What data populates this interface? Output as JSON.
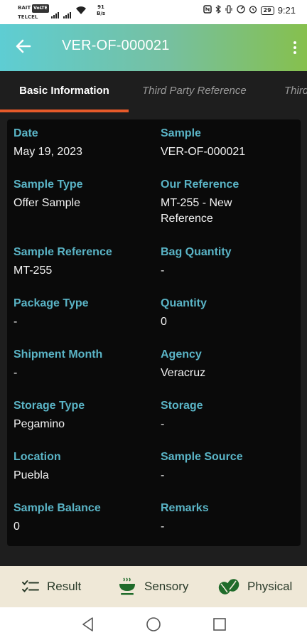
{
  "status_bar": {
    "carrier1": "BAIT",
    "carrier1_badge": "VoLTE",
    "carrier2": "TELCEL",
    "net_speed": "91",
    "net_unit": "B/s",
    "battery": "29",
    "time": "9:21"
  },
  "app_bar": {
    "title": "VER-OF-000021",
    "back_icon": "arrow-left-icon",
    "menu_icon": "more-vert-icon"
  },
  "tabs": [
    {
      "label": "Basic Information",
      "active": true
    },
    {
      "label": "Third Party Reference",
      "active": false
    },
    {
      "label": "Third",
      "active": false
    }
  ],
  "fields": {
    "date": {
      "label": "Date",
      "value": "May 19, 2023"
    },
    "sample": {
      "label": "Sample",
      "value": "VER-OF-000021"
    },
    "sample_type": {
      "label": "Sample Type",
      "value": "Offer Sample"
    },
    "our_reference": {
      "label": "Our Reference",
      "value": "MT-255 - New Reference"
    },
    "sample_reference": {
      "label": "Sample Reference",
      "value": "MT-255"
    },
    "bag_quantity": {
      "label": "Bag Quantity",
      "value": "-"
    },
    "package_type": {
      "label": "Package Type",
      "value": "-"
    },
    "quantity": {
      "label": "Quantity",
      "value": "0"
    },
    "shipment_month": {
      "label": "Shipment Month",
      "value": "-"
    },
    "agency": {
      "label": "Agency",
      "value": "Veracruz"
    },
    "storage_type": {
      "label": "Storage Type",
      "value": "Pegamino"
    },
    "storage": {
      "label": "Storage",
      "value": "-"
    },
    "location": {
      "label": "Location",
      "value": "Puebla"
    },
    "sample_source": {
      "label": "Sample Source",
      "value": "-"
    },
    "sample_balance": {
      "label": "Sample Balance",
      "value": "0"
    },
    "remarks": {
      "label": "Remarks",
      "value": "-"
    }
  },
  "bottom_actions": {
    "result": {
      "label": "Result",
      "icon": "checklist-icon"
    },
    "sensory": {
      "label": "Sensory",
      "icon": "coffee-cup-icon"
    },
    "physical": {
      "label": "Physical",
      "icon": "coffee-beans-icon"
    }
  },
  "colors": {
    "accent_tab": "#e65a2a",
    "label_teal": "#5ab4c6",
    "appbar_start": "#5ecdd3",
    "appbar_end": "#86c04d",
    "bottom_bar_bg": "#efe8d7"
  }
}
